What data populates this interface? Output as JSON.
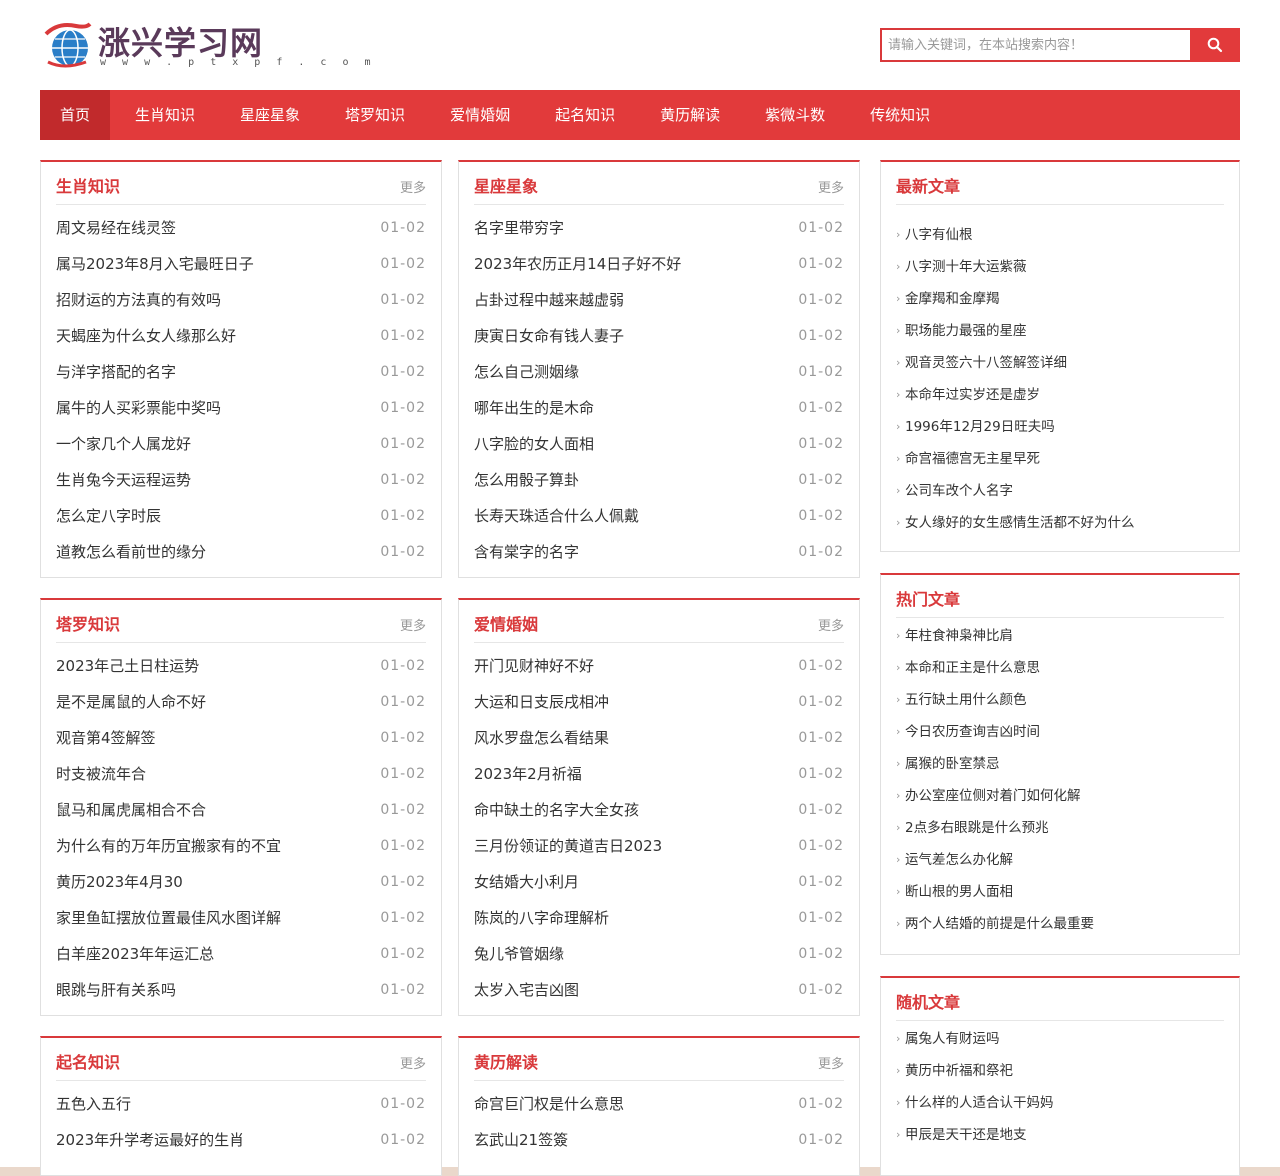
{
  "site": {
    "title": "涨兴学习网",
    "domain": "w w w . p t x p f . c o m"
  },
  "search": {
    "placeholder": "请输入关键词，在本站搜索内容！",
    "icon": "search-icon"
  },
  "nav": {
    "items": [
      "首页",
      "生肖知识",
      "星座星象",
      "塔罗知识",
      "爱情婚姻",
      "起名知识",
      "黄历解读",
      "紫微斗数",
      "传统知识"
    ],
    "active": "首页"
  },
  "colors": {
    "accent": "#e23a3b",
    "accent_dark": "#c12a2c",
    "title_red": "#d9393b"
  },
  "more_label": "更多",
  "sections": [
    {
      "title": "生肖知识",
      "items": [
        {
          "title": "周文易经在线灵签",
          "date": "01-02"
        },
        {
          "title": "属马2023年8月入宅最旺日子",
          "date": "01-02"
        },
        {
          "title": "招财运的方法真的有效吗",
          "date": "01-02"
        },
        {
          "title": "天蝎座为什么女人缘那么好",
          "date": "01-02"
        },
        {
          "title": "与洋字搭配的名字",
          "date": "01-02"
        },
        {
          "title": "属牛的人买彩票能中奖吗",
          "date": "01-02"
        },
        {
          "title": "一个家几个人属龙好",
          "date": "01-02"
        },
        {
          "title": "生肖兔今天运程运势",
          "date": "01-02"
        },
        {
          "title": "怎么定八字时辰",
          "date": "01-02"
        },
        {
          "title": "道教怎么看前世的缘分",
          "date": "01-02"
        }
      ]
    },
    {
      "title": "星座星象",
      "items": [
        {
          "title": "名字里带穷字",
          "date": "01-02"
        },
        {
          "title": "2023年农历正月14日子好不好",
          "date": "01-02"
        },
        {
          "title": "占卦过程中越来越虚弱",
          "date": "01-02"
        },
        {
          "title": "庚寅日女命有钱人妻子",
          "date": "01-02"
        },
        {
          "title": "怎么自己测姻缘",
          "date": "01-02"
        },
        {
          "title": "哪年出生的是木命",
          "date": "01-02"
        },
        {
          "title": "八字脸的女人面相",
          "date": "01-02"
        },
        {
          "title": "怎么用骰子算卦",
          "date": "01-02"
        },
        {
          "title": "长寿天珠适合什么人佩戴",
          "date": "01-02"
        },
        {
          "title": "含有棠字的名字",
          "date": "01-02"
        }
      ]
    },
    {
      "title": "塔罗知识",
      "items": [
        {
          "title": "2023年己土日柱运势",
          "date": "01-02"
        },
        {
          "title": "是不是属鼠的人命不好",
          "date": "01-02"
        },
        {
          "title": "观音第4签解签",
          "date": "01-02"
        },
        {
          "title": "时支被流年合",
          "date": "01-02"
        },
        {
          "title": "鼠马和属虎属相合不合",
          "date": "01-02"
        },
        {
          "title": "为什么有的万年历宜搬家有的不宜",
          "date": "01-02"
        },
        {
          "title": "黄历2023年4月30",
          "date": "01-02"
        },
        {
          "title": "家里鱼缸摆放位置最佳风水图详解",
          "date": "01-02"
        },
        {
          "title": "白羊座2023年年运汇总",
          "date": "01-02"
        },
        {
          "title": "眼跳与肝有关系吗",
          "date": "01-02"
        }
      ]
    },
    {
      "title": "爱情婚姻",
      "items": [
        {
          "title": "开门见财神好不好",
          "date": "01-02"
        },
        {
          "title": "大运和日支辰戌相冲",
          "date": "01-02"
        },
        {
          "title": "风水罗盘怎么看结果",
          "date": "01-02"
        },
        {
          "title": "2023年2月祈福",
          "date": "01-02"
        },
        {
          "title": "命中缺土的名字大全女孩",
          "date": "01-02"
        },
        {
          "title": "三月份领证的黄道吉日2023",
          "date": "01-02"
        },
        {
          "title": "女结婚大小利月",
          "date": "01-02"
        },
        {
          "title": "陈岚的八字命理解析",
          "date": "01-02"
        },
        {
          "title": "兔儿爷管姻缘",
          "date": "01-02"
        },
        {
          "title": "太岁入宅吉凶图",
          "date": "01-02"
        }
      ]
    },
    {
      "title": "起名知识",
      "items": [
        {
          "title": "五色入五行",
          "date": "01-02"
        },
        {
          "title": "2023年升学考运最好的生肖",
          "date": "01-02"
        }
      ]
    },
    {
      "title": "黄历解读",
      "items": [
        {
          "title": "命宫巨门权是什么意思",
          "date": "01-02"
        },
        {
          "title": "玄武山21签簽",
          "date": "01-02"
        }
      ]
    }
  ],
  "sidebar": [
    {
      "title": "最新文章",
      "items": [
        "八字有仙根",
        "八字测十年大运紫薇",
        "金摩羯和金摩羯",
        "职场能力最强的星座",
        "观音灵签六十八签解签详细",
        "本命年过实岁还是虚岁",
        "1996年12月29日旺夫吗",
        "命宫福德宫无主星早死",
        "公司车改个人名字",
        "女人缘好的女生感情生活都不好为什么"
      ]
    },
    {
      "title": "热门文章",
      "items": [
        "年柱食神枭神比肩",
        "本命和正主是什么意思",
        "五行缺土用什么颜色",
        "今日农历查询吉凶时间",
        "属猴的卧室禁忌",
        "办公室座位侧对着门如何化解",
        "2点多右眼跳是什么预兆",
        "运气差怎么办化解",
        "断山根的男人面相",
        "两个人结婚的前提是什么最重要"
      ]
    },
    {
      "title": "随机文章",
      "items": [
        "属兔人有财运吗",
        "黄历中祈福和祭祀",
        "什么样的人适合认干妈妈",
        "甲辰是天干还是地支"
      ]
    }
  ]
}
